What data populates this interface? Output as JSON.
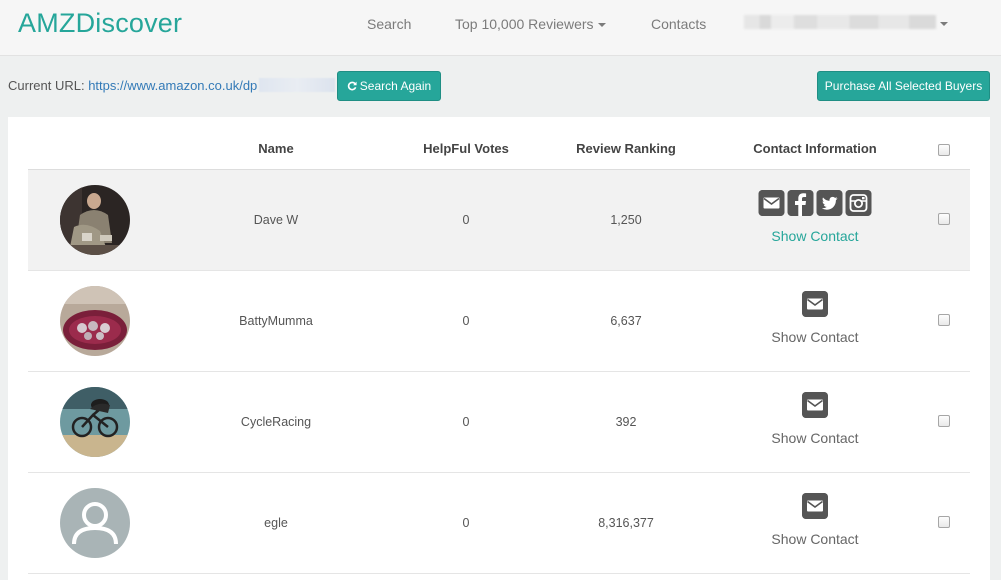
{
  "brand": "AMZDiscover",
  "nav": {
    "search": "Search",
    "top_reviewers": "Top 10,000 Reviewers",
    "contacts": "Contacts"
  },
  "toolbar": {
    "url_label": "Current URL:",
    "url_value": "https://www.amazon.co.uk/dp",
    "search_again": "Search Again",
    "purchase_all": "Purchase All Selected Buyers"
  },
  "table": {
    "headers": {
      "name": "Name",
      "votes": "HelpFul Votes",
      "ranking": "Review Ranking",
      "contact": "Contact Information"
    },
    "rows": [
      {
        "name": "Dave W",
        "votes": "0",
        "ranking": "1,250",
        "contact_label": "Show Contact",
        "icons": [
          "envelope-icon",
          "facebook-icon",
          "twitter-icon",
          "instagram-icon"
        ]
      },
      {
        "name": "BattyMumma",
        "votes": "0",
        "ranking": "6,637",
        "contact_label": "Show Contact",
        "icons": [
          "envelope-icon"
        ]
      },
      {
        "name": "CycleRacing",
        "votes": "0",
        "ranking": "392",
        "contact_label": "Show Contact",
        "icons": [
          "envelope-icon"
        ]
      },
      {
        "name": "egle",
        "votes": "0",
        "ranking": "8,316,377",
        "contact_label": "Show Contact",
        "icons": [
          "envelope-icon"
        ]
      }
    ]
  },
  "colors": {
    "brand": "#26a69a",
    "link": "#337ab7",
    "icon": "#555555",
    "show_contact_active": "#26a69a",
    "show_contact": "#666666"
  }
}
